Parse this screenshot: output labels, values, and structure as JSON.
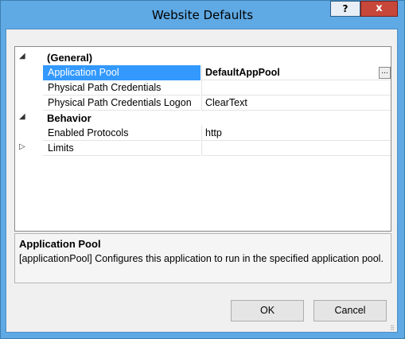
{
  "window": {
    "title": "Website Defaults",
    "help_label": "?",
    "close_label": "x"
  },
  "grid": {
    "rows": [
      {
        "kind": "category",
        "label": "(General)",
        "glyph": "◢"
      },
      {
        "kind": "property",
        "name": "Application Pool",
        "value": "DefaultAppPool",
        "selected": true,
        "has_button": true,
        "button_label": "..."
      },
      {
        "kind": "property",
        "name": "Physical Path Credentials",
        "value": ""
      },
      {
        "kind": "property",
        "name": "Physical Path Credentials Logon",
        "value": "ClearText"
      },
      {
        "kind": "category",
        "label": "Behavior",
        "glyph": "◢"
      },
      {
        "kind": "property",
        "name": "Enabled Protocols",
        "value": "http"
      },
      {
        "kind": "collapsed",
        "name": "Limits",
        "value": "",
        "glyph": "▷"
      }
    ]
  },
  "description": {
    "title": "Application Pool",
    "text": "[applicationPool] Configures this application to run in the specified application pool."
  },
  "buttons": {
    "ok": "OK",
    "cancel": "Cancel"
  },
  "colors": {
    "frame": "#5fa9e4",
    "selection": "#3399ff",
    "close": "#c7473a"
  }
}
